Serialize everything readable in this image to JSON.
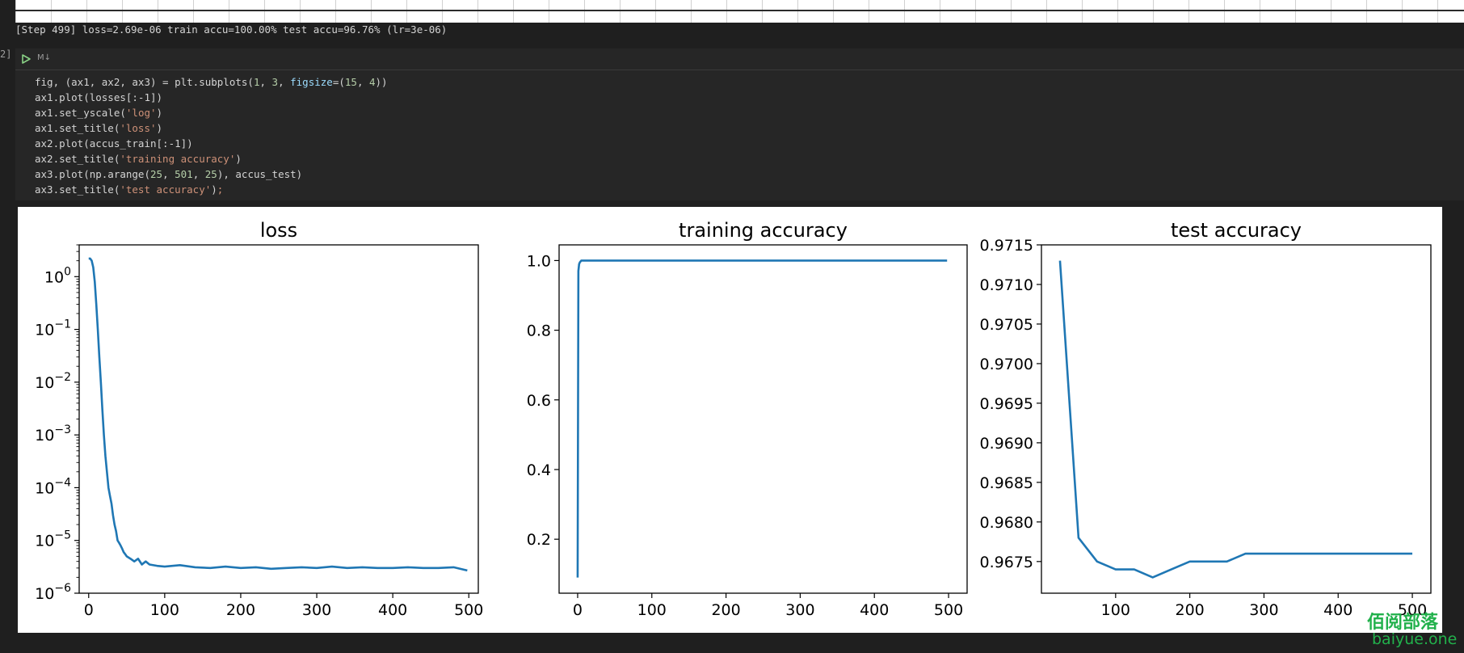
{
  "stdout_line": "[Step 499] loss=2.69e-06 train accu=100.00% test accu=96.76% (lr=3e-06)",
  "cell": {
    "execution_count": "2]",
    "language_badge": "M↓",
    "run_icon": "run-cell-icon",
    "code_lines": [
      [
        {
          "t": "fig, (ax1, ax2, ax3) = plt.subplots(",
          "c": "default"
        },
        {
          "t": "1",
          "c": "num"
        },
        {
          "t": ", ",
          "c": "default"
        },
        {
          "t": "3",
          "c": "num"
        },
        {
          "t": ", ",
          "c": "default"
        },
        {
          "t": "figsize",
          "c": "kw"
        },
        {
          "t": "=(",
          "c": "default"
        },
        {
          "t": "15",
          "c": "num"
        },
        {
          "t": ", ",
          "c": "default"
        },
        {
          "t": "4",
          "c": "num"
        },
        {
          "t": "))",
          "c": "default"
        }
      ],
      [
        {
          "t": "ax1.plot(losses[:-1])",
          "c": "default"
        }
      ],
      [
        {
          "t": "ax1.set_yscale(",
          "c": "default"
        },
        {
          "t": "'log'",
          "c": "str"
        },
        {
          "t": ")",
          "c": "default"
        }
      ],
      [
        {
          "t": "ax1.set_title(",
          "c": "default"
        },
        {
          "t": "'loss'",
          "c": "str"
        },
        {
          "t": ")",
          "c": "default"
        }
      ],
      [
        {
          "t": "ax2.plot(accus_train[:-1])",
          "c": "default"
        }
      ],
      [
        {
          "t": "ax2.set_title(",
          "c": "default"
        },
        {
          "t": "'training accuracy'",
          "c": "str"
        },
        {
          "t": ")",
          "c": "default"
        }
      ],
      [
        {
          "t": "ax3.plot(np.arange(",
          "c": "default"
        },
        {
          "t": "25",
          "c": "num"
        },
        {
          "t": ", ",
          "c": "default"
        },
        {
          "t": "501",
          "c": "num"
        },
        {
          "t": ", ",
          "c": "default"
        },
        {
          "t": "25",
          "c": "num"
        },
        {
          "t": "), accus_test)",
          "c": "default"
        }
      ],
      [
        {
          "t": "ax3.set_title(",
          "c": "default"
        },
        {
          "t": "'test accuracy'",
          "c": "str"
        },
        {
          "t": ")",
          "c": "default"
        },
        {
          "t": ";",
          "c": "str"
        }
      ]
    ]
  },
  "watermark": {
    "main": "佰阅部落",
    "sub": "baiyue.one",
    "color": "#22b14c"
  },
  "colors": {
    "line": "#1f77b4",
    "background": "#1f1f1f",
    "cell_background": "#262626"
  },
  "chart_data": [
    {
      "type": "line",
      "title": "loss",
      "yscale": "log",
      "xlim": [
        -12.5,
        512.5
      ],
      "ylim": [
        1e-06,
        4
      ],
      "xticks": [
        0,
        100,
        200,
        300,
        400,
        500
      ],
      "xtick_labels": [
        "0",
        "100",
        "200",
        "300",
        "400",
        "500"
      ],
      "yticks": [
        1,
        0.1,
        0.01,
        0.001,
        0.0001,
        1e-05,
        1e-06
      ],
      "ytick_base": "10",
      "ytick_exponents": [
        "0",
        "−1",
        "−2",
        "−3",
        "−4",
        "−5",
        "−6"
      ],
      "series": [
        {
          "x": [
            0,
            2,
            4,
            6,
            8,
            10,
            12,
            14,
            16,
            18,
            20,
            22,
            24,
            26,
            28,
            30,
            32,
            34,
            36,
            38,
            40,
            42,
            44,
            46,
            48,
            50,
            55,
            60,
            65,
            70,
            75,
            80,
            90,
            100,
            120,
            140,
            160,
            180,
            200,
            220,
            240,
            260,
            280,
            300,
            320,
            340,
            360,
            380,
            400,
            420,
            440,
            460,
            480,
            498
          ],
          "y": [
            2.2,
            2.2,
            2.0,
            1.5,
            0.8,
            0.3,
            0.1,
            0.03,
            0.01,
            0.003,
            0.001,
            0.0004,
            0.0002,
            0.0001,
            7e-05,
            5e-05,
            3e-05,
            2e-05,
            1.5e-05,
            1e-05,
            9e-06,
            8e-06,
            7e-06,
            6e-06,
            5.5e-06,
            5e-06,
            4.5e-06,
            4e-06,
            4.5e-06,
            3.5e-06,
            4e-06,
            3.5e-06,
            3.3e-06,
            3.2e-06,
            3.4e-06,
            3.1e-06,
            3e-06,
            3.2e-06,
            3e-06,
            3.1e-06,
            2.9e-06,
            3e-06,
            3.1e-06,
            3e-06,
            3.2e-06,
            3e-06,
            3.1e-06,
            3e-06,
            3e-06,
            3.1e-06,
            3e-06,
            3e-06,
            3.1e-06,
            2.7e-06
          ]
        }
      ]
    },
    {
      "type": "line",
      "title": "training accuracy",
      "xlim": [
        -25,
        525
      ],
      "ylim": [
        0.045,
        1.045
      ],
      "xticks": [
        0,
        100,
        200,
        300,
        400,
        500
      ],
      "xtick_labels": [
        "0",
        "100",
        "200",
        "300",
        "400",
        "500"
      ],
      "yticks": [
        0.2,
        0.4,
        0.6,
        0.8,
        1.0
      ],
      "ytick_labels": [
        "0.2",
        "0.4",
        "0.6",
        "0.8",
        "1.0"
      ],
      "series": [
        {
          "x": [
            0,
            1,
            2,
            3,
            5,
            10,
            50,
            100,
            200,
            300,
            400,
            498
          ],
          "y": [
            0.09,
            0.97,
            0.99,
            0.995,
            1.0,
            1.0,
            1.0,
            1.0,
            1.0,
            1.0,
            1.0,
            1.0
          ]
        }
      ]
    },
    {
      "type": "line",
      "title": "test accuracy",
      "xlim": [
        0,
        525
      ],
      "ylim": [
        0.9671,
        0.9715
      ],
      "xticks": [
        100,
        200,
        300,
        400,
        500
      ],
      "xtick_labels": [
        "100",
        "200",
        "300",
        "400",
        "500"
      ],
      "yticks": [
        0.9675,
        0.968,
        0.9685,
        0.969,
        0.9695,
        0.97,
        0.9705,
        0.971,
        0.9715
      ],
      "ytick_labels": [
        "0.9675",
        "0.9680",
        "0.9685",
        "0.9690",
        "0.9695",
        "0.9700",
        "0.9705",
        "0.9710",
        "0.9715"
      ],
      "series": [
        {
          "x": [
            25,
            50,
            75,
            100,
            125,
            150,
            175,
            200,
            225,
            250,
            275,
            300,
            325,
            350,
            375,
            400,
            425,
            450,
            475,
            500
          ],
          "y": [
            0.9713,
            0.9678,
            0.9675,
            0.9674,
            0.9674,
            0.9673,
            0.9674,
            0.9675,
            0.9675,
            0.9675,
            0.9676,
            0.9676,
            0.9676,
            0.9676,
            0.9676,
            0.9676,
            0.9676,
            0.9676,
            0.9676,
            0.9676
          ]
        }
      ]
    }
  ]
}
